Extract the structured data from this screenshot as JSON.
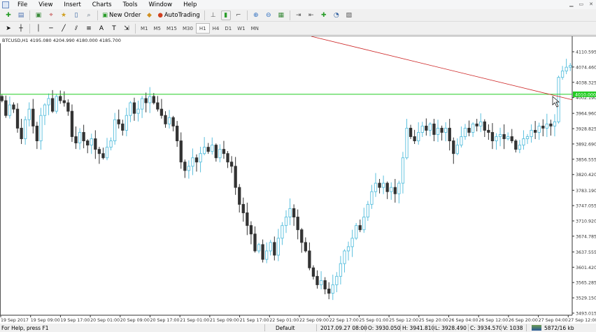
{
  "menu": {
    "items": [
      "File",
      "View",
      "Insert",
      "Charts",
      "Tools",
      "Window",
      "Help"
    ]
  },
  "toolbar": {
    "new_order": "New Order",
    "autotrading": "AutoTrading",
    "timeframes": [
      "M1",
      "M5",
      "M15",
      "M30",
      "H1",
      "H4",
      "D1",
      "W1",
      "MN"
    ],
    "active_timeframe": "H1"
  },
  "chart": {
    "title": "BTCUSD,H1  4195.080 4204.990 4180.000 4185.700",
    "price_labels": [
      "4110.595",
      "4074.460",
      "4038.325",
      "4002.190",
      "3964.960",
      "3928.825",
      "3892.690",
      "3856.555",
      "3820.420",
      "3783.190",
      "3747.055",
      "3710.920",
      "3674.785",
      "3637.555",
      "3601.420",
      "3565.285",
      "3529.150",
      "3493.015"
    ],
    "time_labels": [
      "19 Sep 2017",
      "19 Sep 09:00",
      "19 Sep 17:00",
      "20 Sep 01:00",
      "20 Sep 09:00",
      "20 Sep 17:00",
      "21 Sep 01:00",
      "21 Sep 09:00",
      "21 Sep 17:00",
      "22 Sep 01:00",
      "22 Sep 09:00",
      "22 Sep 17:00",
      "25 Sep 01:00",
      "25 Sep 12:00",
      "25 Sep 20:00",
      "26 Sep 04:00",
      "26 Sep 12:00",
      "26 Sep 20:00",
      "27 Sep 04:00",
      "27 Sep 12:00"
    ],
    "hline_price": 4010.0,
    "hline_label": "4010.000",
    "colors": {
      "bull_outline": "#5bc0de",
      "bull_fill": "#ffffff",
      "bear": "#333333",
      "hline": "#22cc22",
      "trendline": "#cc2222"
    },
    "trendline": {
      "from_price": 4110.595,
      "to_price": 3997
    },
    "closes": [
      3995,
      3960,
      3985,
      3975,
      3930,
      3905,
      3950,
      3975,
      3935,
      3900,
      3960,
      3985,
      4000,
      3970,
      4005,
      3995,
      3990,
      3970,
      3910,
      3895,
      3920,
      3900,
      3890,
      3905,
      3880,
      3870,
      3860,
      3885,
      3900,
      3950,
      3940,
      3925,
      3960,
      3990,
      3965,
      3975,
      4000,
      3990,
      4005,
      3990,
      3975,
      3960,
      3940,
      3955,
      3935,
      3900,
      3850,
      3830,
      3840,
      3860,
      3850,
      3870,
      3885,
      3875,
      3890,
      3860,
      3880,
      3870,
      3850,
      3840,
      3790,
      3750,
      3730,
      3700,
      3680,
      3640,
      3655,
      3620,
      3640,
      3660,
      3630,
      3670,
      3700,
      3720,
      3740,
      3720,
      3690,
      3660,
      3640,
      3600,
      3580,
      3560,
      3570,
      3550,
      3540,
      3560,
      3580,
      3610,
      3640,
      3650,
      3670,
      3700,
      3690,
      3720,
      3750,
      3780,
      3800,
      3790,
      3800,
      3780,
      3790,
      3775,
      3800,
      3860,
      3930,
      3910,
      3900,
      3920,
      3935,
      3925,
      3940,
      3915,
      3930,
      3920,
      3930,
      3900,
      3870,
      3890,
      3910,
      3930,
      3920,
      3940,
      3935,
      3945,
      3925,
      3920,
      3900,
      3910,
      3915,
      3905,
      3910,
      3900,
      3880,
      3890,
      3905,
      3910,
      3925,
      3920,
      3935,
      3930,
      3940,
      3935,
      3945,
      4050,
      4065,
      4074,
      4078
    ]
  },
  "status": {
    "help": "For Help, press F1",
    "profile": "Default",
    "datetime": "2017.09.27 08:00",
    "open": "O: 3930.050",
    "high": "H: 3941.810",
    "low": "L: 3928.490",
    "close": "C: 3934.570",
    "volume": "V: 1038",
    "traffic": "5872/16 kb"
  }
}
